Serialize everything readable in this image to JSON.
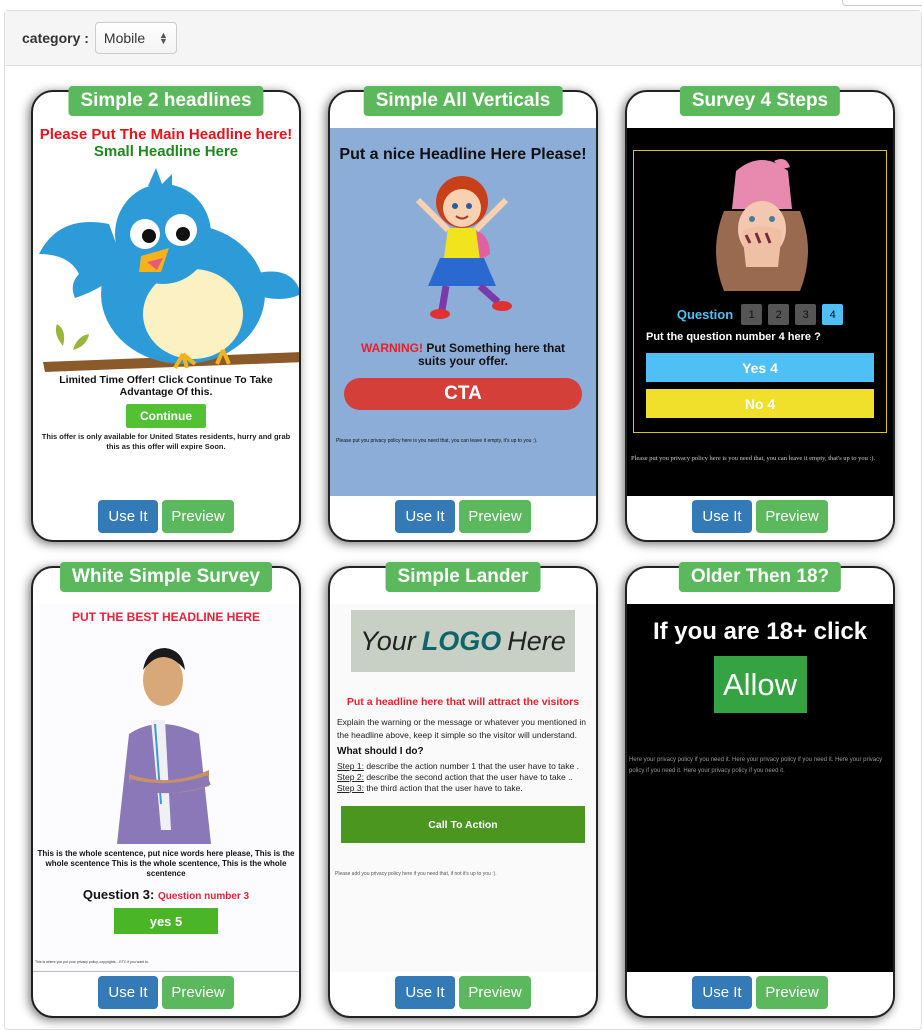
{
  "filter": {
    "label": "category :",
    "selected": "Mobile"
  },
  "card_actions": {
    "use_label": "Use It",
    "preview_label": "Preview"
  },
  "templates": [
    {
      "title": "Simple 2 headlines",
      "headline": "Please Put The Main Headline here!",
      "subheadline": "Small Headline Here",
      "offer_text": "Limited Time Offer! Click Continue To Take Advantage Of this.",
      "button": "Continue",
      "note": "This offer is only available for United States residents, hurry and grab this as this offer will expire Soon."
    },
    {
      "title": "Simple All Verticals",
      "headline": "Put a nice Headline Here Please!",
      "warning_prefix": "WARNING!",
      "warning_text": "Put Something here that suits your offer.",
      "cta": "CTA",
      "privacy": "Please put you privacy policy here is you need that, you can leave it empty, it's up to you :)."
    },
    {
      "title": "Survey 4 Steps",
      "question_label": "Question",
      "steps": [
        "1",
        "2",
        "3",
        "4"
      ],
      "active_step": 4,
      "question": "Put the question number 4 here ?",
      "yes": "Yes 4",
      "no": "No 4",
      "privacy": "Please put you privacy policy here is you need that, you can leave it empty, that's up to you :)."
    },
    {
      "title": "White Simple Survey",
      "headline": "PUT THE BEST HEADLINE HERE",
      "sentence": "This is the whole scentence, put nice words here please, This is the whole scentence This is the whole scentence, This is the whole scentence",
      "question_prefix": "Question 3:",
      "question": "Question number 3",
      "answer": "yes 5",
      "privacy": "This is where you put your privacy policy, copyrights, ..ETC if you want to."
    },
    {
      "title": "Simple Lander",
      "logo_pre": "Your",
      "logo_bold": "LOGO",
      "logo_post": "Here",
      "headline": "Put a headline here that will attract the visitors",
      "paragraph": "Explain the warning or the message or whatever you mentioned in the headline above, keep it simple so the visitor will understand.",
      "what_heading": "What should I do?",
      "steps": [
        {
          "label": "Step 1:",
          "text": "describe the action number 1 that the user have to take ."
        },
        {
          "label": "Step 2:",
          "text": "describe the second action that the user have to take .."
        },
        {
          "label": "Step 3:",
          "text": "the third action that the user have to take."
        }
      ],
      "cta": "Call To Action",
      "privacy": "Please add you privacy policy here if you need that, if not it's up to you :)."
    },
    {
      "title": "Older Then 18?",
      "headline": "If you are 18+ click",
      "button": "Allow",
      "privacy": "Here your privacy policy if you need it. Here your privacy policy if you need it. Here your privacy policy if you need it. Here your privacy policy if you need it."
    }
  ]
}
